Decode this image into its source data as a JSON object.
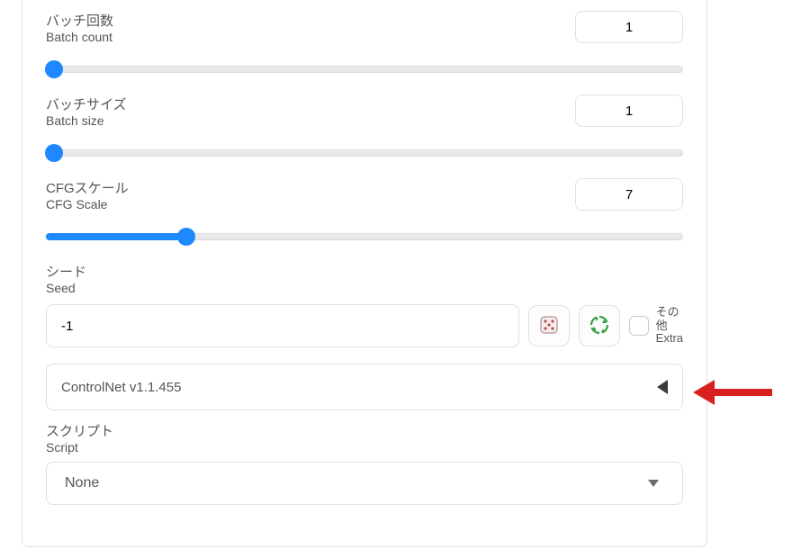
{
  "batch_count": {
    "label_ja": "バッチ回数",
    "label_en": "Batch count",
    "value": "1",
    "slider_percent": 0
  },
  "batch_size": {
    "label_ja": "バッチサイズ",
    "label_en": "Batch size",
    "value": "1",
    "slider_percent": 0
  },
  "cfg_scale": {
    "label_ja": "CFGスケール",
    "label_en": "CFG Scale",
    "value": "7",
    "slider_percent": 22
  },
  "seed": {
    "label_ja": "シード",
    "label_en": "Seed",
    "value": "-1"
  },
  "extra": {
    "label_ja_line1": "その",
    "label_ja_line2": "他",
    "label_en": "Extra",
    "checked": false
  },
  "controlnet": {
    "title": "ControlNet v1.1.455",
    "expanded": false
  },
  "script": {
    "label_ja": "スクリプト",
    "label_en": "Script",
    "selected": "None"
  },
  "icons": {
    "dice": "dice-icon",
    "recycle": "recycle-icon"
  }
}
